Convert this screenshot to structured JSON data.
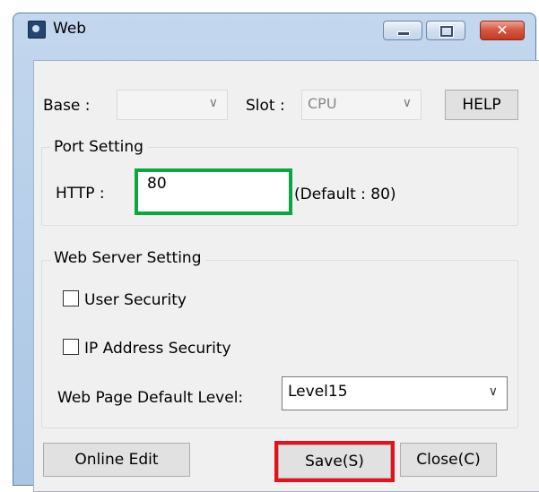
{
  "window": {
    "title": "Web",
    "close_glyph": "✕",
    "icons": [
      "app-icon",
      "minimize-icon",
      "maximize-icon",
      "close-icon"
    ]
  },
  "top_row": {
    "base_label": "Base :",
    "base_value": "",
    "slot_label": "Slot :",
    "slot_value": "CPU",
    "dropdown_glyph": "∨",
    "help_label": "HELP"
  },
  "port_setting": {
    "title": "Port Setting",
    "http_label": "HTTP :",
    "http_value": "80",
    "default_text": "(Default : 80)"
  },
  "web_server_setting": {
    "title": "Web Server Setting",
    "user_security_label": "User Security",
    "user_security_checked": false,
    "ip_security_label": "IP Address Security",
    "ip_security_checked": false,
    "default_level_label": "Web Page Default Level:",
    "default_level_value": "Level15",
    "dropdown_glyph": "∨"
  },
  "buttons": {
    "online_edit": "Online Edit",
    "save": "Save(S)",
    "close": "Close(C)"
  },
  "colors": {
    "http_highlight": "#0aa83c",
    "save_highlight": "#e8101a"
  }
}
